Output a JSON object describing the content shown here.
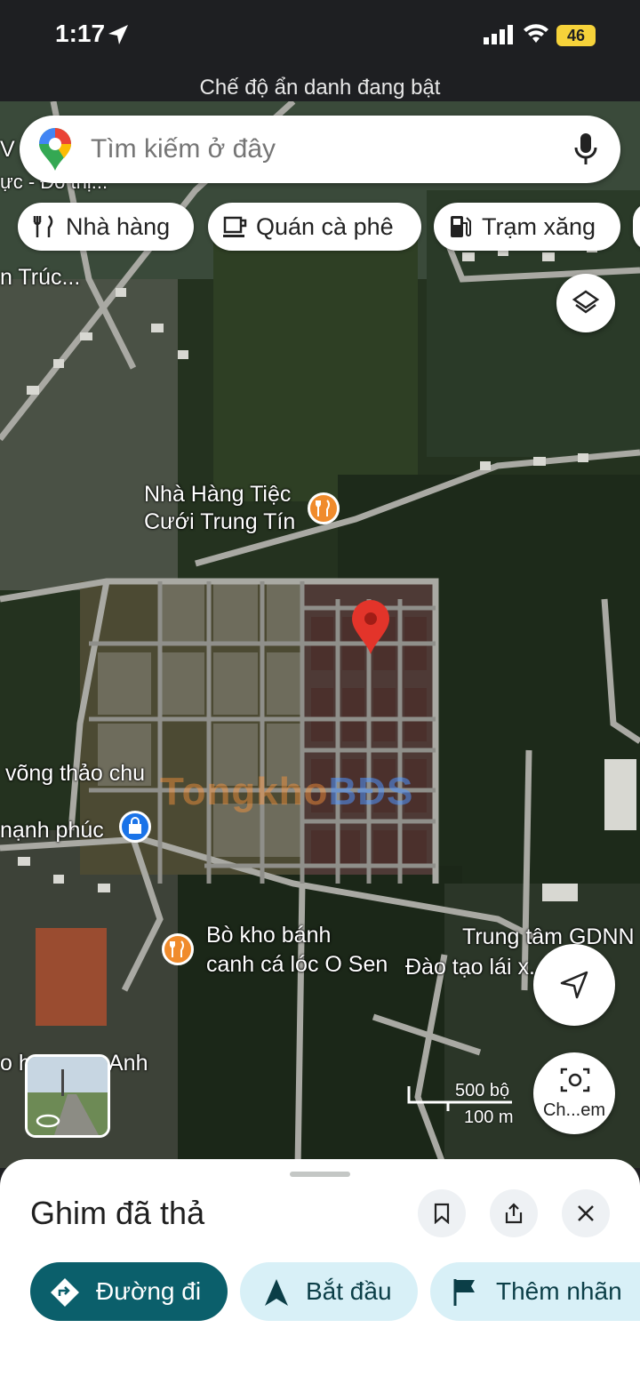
{
  "status_bar": {
    "time": "1:17",
    "battery": "46"
  },
  "incognito_banner": "Chế độ ẩn danh đang bật",
  "search": {
    "placeholder": "Tìm kiếm ở đây"
  },
  "chips": [
    {
      "label": "Nhà hàng",
      "icon": "restaurant-icon"
    },
    {
      "label": "Quán cà phê",
      "icon": "coffee-icon"
    },
    {
      "label": "Trạm xăng",
      "icon": "gas-station-icon"
    }
  ],
  "map_labels": {
    "top_left_1": "V",
    "top_left_2": "ực - Đô thị...",
    "truc": "n Trúc...",
    "restaurant_name_line1": "Nhà Hàng Tiệc",
    "restaurant_name_line2": "Cưới Trung Tín",
    "vong_thao": "võng thảo chu",
    "hanh_phuc": "nạnh phúc",
    "bo_kho_line1": "Bò kho bánh",
    "bo_kho_line2": "canh cá lóc O Sen",
    "trung_tam_line1": "Trung tâm GDNN",
    "trung_tam_line2": "Đào tạo lái x...nh...",
    "bottom_left": "o h...",
    "anh": "Anh",
    "watermark_part1": "Tongkho",
    "watermark_part2": "BĐS"
  },
  "scale": {
    "imperial": "500 bộ",
    "metric": "100 m"
  },
  "street_view_label": "Ch...em",
  "sheet": {
    "title": "Ghim đã thả",
    "actions": [
      {
        "label": "Đường đi",
        "icon": "directions-icon"
      },
      {
        "label": "Bắt đầu",
        "icon": "navigation-start-icon"
      },
      {
        "label": "Thêm nhãn",
        "icon": "flag-icon"
      }
    ]
  },
  "colors": {
    "accent_teal": "#0b5f6b",
    "light_teal": "#d8f0f7",
    "pin_red": "#e3342a",
    "poi_orange": "#f08b2c",
    "poi_blue": "#1a73e8"
  }
}
